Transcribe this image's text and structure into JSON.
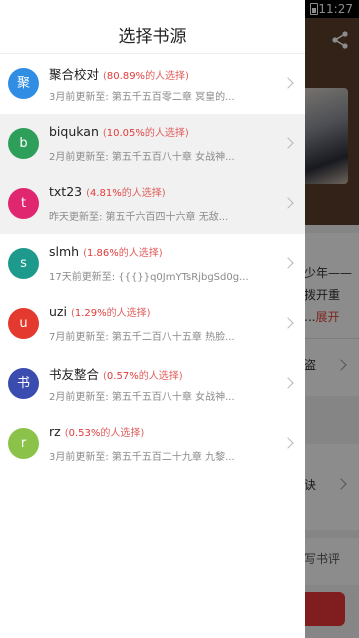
{
  "status_bar": {
    "time": "11:27"
  },
  "background_page": {
    "intro_lines": [
      "少年——",
      "拨开重",
      "..."
    ],
    "intro_more": "展开",
    "item_1": "盗",
    "item_2": "诀",
    "review": "写书评"
  },
  "drawer": {
    "title": "选择书源",
    "pct_prefix": "(",
    "pct_suffix": "的人选择)",
    "sources": [
      {
        "avatar": "聚",
        "color": "#2f8de4",
        "name": "聚合校对",
        "percent": "80.89%",
        "update": "3月前更新至: 第五千五百零二章 冥皇的..."
      },
      {
        "avatar": "b",
        "color": "#2e9f5b",
        "name": "biqukan",
        "percent": "10.05%",
        "update": "2月前更新至: 第五千五百八十章 女战神..."
      },
      {
        "avatar": "t",
        "color": "#e0266e",
        "name": "txt23",
        "percent": "4.81%",
        "update": "昨天更新至: 第五千六百四十六章 无敌..."
      },
      {
        "avatar": "s",
        "color": "#1d9a8c",
        "name": "slmh",
        "percent": "1.86%",
        "update": "17天前更新至: {{{}}q0JmYTsRjbgSd0g..."
      },
      {
        "avatar": "u",
        "color": "#e4392f",
        "name": "uzi",
        "percent": "1.29%",
        "update": "7月前更新至: 第五千二百八十五章 热脸..."
      },
      {
        "avatar": "书",
        "color": "#3a4cb0",
        "name": "书友整合",
        "percent": "0.57%",
        "update": "2月前更新至: 第五千五百八十章 女战神..."
      },
      {
        "avatar": "r",
        "color": "#8bc34a",
        "name": "rz",
        "percent": "0.53%",
        "update": "3月前更新至: 第五千五百二十九章 九黎..."
      }
    ]
  }
}
